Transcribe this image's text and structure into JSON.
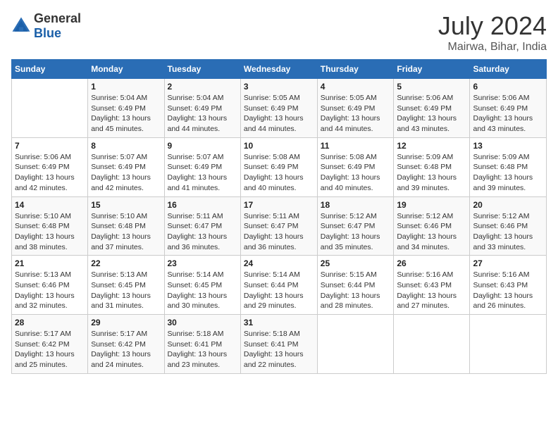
{
  "logo": {
    "general": "General",
    "blue": "Blue"
  },
  "title": "July 2024",
  "subtitle": "Mairwa, Bihar, India",
  "header_days": [
    "Sunday",
    "Monday",
    "Tuesday",
    "Wednesday",
    "Thursday",
    "Friday",
    "Saturday"
  ],
  "weeks": [
    [
      {
        "day": "",
        "info": ""
      },
      {
        "day": "1",
        "info": "Sunrise: 5:04 AM\nSunset: 6:49 PM\nDaylight: 13 hours\nand 45 minutes."
      },
      {
        "day": "2",
        "info": "Sunrise: 5:04 AM\nSunset: 6:49 PM\nDaylight: 13 hours\nand 44 minutes."
      },
      {
        "day": "3",
        "info": "Sunrise: 5:05 AM\nSunset: 6:49 PM\nDaylight: 13 hours\nand 44 minutes."
      },
      {
        "day": "4",
        "info": "Sunrise: 5:05 AM\nSunset: 6:49 PM\nDaylight: 13 hours\nand 44 minutes."
      },
      {
        "day": "5",
        "info": "Sunrise: 5:06 AM\nSunset: 6:49 PM\nDaylight: 13 hours\nand 43 minutes."
      },
      {
        "day": "6",
        "info": "Sunrise: 5:06 AM\nSunset: 6:49 PM\nDaylight: 13 hours\nand 43 minutes."
      }
    ],
    [
      {
        "day": "7",
        "info": "Sunrise: 5:06 AM\nSunset: 6:49 PM\nDaylight: 13 hours\nand 42 minutes."
      },
      {
        "day": "8",
        "info": "Sunrise: 5:07 AM\nSunset: 6:49 PM\nDaylight: 13 hours\nand 42 minutes."
      },
      {
        "day": "9",
        "info": "Sunrise: 5:07 AM\nSunset: 6:49 PM\nDaylight: 13 hours\nand 41 minutes."
      },
      {
        "day": "10",
        "info": "Sunrise: 5:08 AM\nSunset: 6:49 PM\nDaylight: 13 hours\nand 40 minutes."
      },
      {
        "day": "11",
        "info": "Sunrise: 5:08 AM\nSunset: 6:49 PM\nDaylight: 13 hours\nand 40 minutes."
      },
      {
        "day": "12",
        "info": "Sunrise: 5:09 AM\nSunset: 6:48 PM\nDaylight: 13 hours\nand 39 minutes."
      },
      {
        "day": "13",
        "info": "Sunrise: 5:09 AM\nSunset: 6:48 PM\nDaylight: 13 hours\nand 39 minutes."
      }
    ],
    [
      {
        "day": "14",
        "info": "Sunrise: 5:10 AM\nSunset: 6:48 PM\nDaylight: 13 hours\nand 38 minutes."
      },
      {
        "day": "15",
        "info": "Sunrise: 5:10 AM\nSunset: 6:48 PM\nDaylight: 13 hours\nand 37 minutes."
      },
      {
        "day": "16",
        "info": "Sunrise: 5:11 AM\nSunset: 6:47 PM\nDaylight: 13 hours\nand 36 minutes."
      },
      {
        "day": "17",
        "info": "Sunrise: 5:11 AM\nSunset: 6:47 PM\nDaylight: 13 hours\nand 36 minutes."
      },
      {
        "day": "18",
        "info": "Sunrise: 5:12 AM\nSunset: 6:47 PM\nDaylight: 13 hours\nand 35 minutes."
      },
      {
        "day": "19",
        "info": "Sunrise: 5:12 AM\nSunset: 6:46 PM\nDaylight: 13 hours\nand 34 minutes."
      },
      {
        "day": "20",
        "info": "Sunrise: 5:12 AM\nSunset: 6:46 PM\nDaylight: 13 hours\nand 33 minutes."
      }
    ],
    [
      {
        "day": "21",
        "info": "Sunrise: 5:13 AM\nSunset: 6:46 PM\nDaylight: 13 hours\nand 32 minutes."
      },
      {
        "day": "22",
        "info": "Sunrise: 5:13 AM\nSunset: 6:45 PM\nDaylight: 13 hours\nand 31 minutes."
      },
      {
        "day": "23",
        "info": "Sunrise: 5:14 AM\nSunset: 6:45 PM\nDaylight: 13 hours\nand 30 minutes."
      },
      {
        "day": "24",
        "info": "Sunrise: 5:14 AM\nSunset: 6:44 PM\nDaylight: 13 hours\nand 29 minutes."
      },
      {
        "day": "25",
        "info": "Sunrise: 5:15 AM\nSunset: 6:44 PM\nDaylight: 13 hours\nand 28 minutes."
      },
      {
        "day": "26",
        "info": "Sunrise: 5:16 AM\nSunset: 6:43 PM\nDaylight: 13 hours\nand 27 minutes."
      },
      {
        "day": "27",
        "info": "Sunrise: 5:16 AM\nSunset: 6:43 PM\nDaylight: 13 hours\nand 26 minutes."
      }
    ],
    [
      {
        "day": "28",
        "info": "Sunrise: 5:17 AM\nSunset: 6:42 PM\nDaylight: 13 hours\nand 25 minutes."
      },
      {
        "day": "29",
        "info": "Sunrise: 5:17 AM\nSunset: 6:42 PM\nDaylight: 13 hours\nand 24 minutes."
      },
      {
        "day": "30",
        "info": "Sunrise: 5:18 AM\nSunset: 6:41 PM\nDaylight: 13 hours\nand 23 minutes."
      },
      {
        "day": "31",
        "info": "Sunrise: 5:18 AM\nSunset: 6:41 PM\nDaylight: 13 hours\nand 22 minutes."
      },
      {
        "day": "",
        "info": ""
      },
      {
        "day": "",
        "info": ""
      },
      {
        "day": "",
        "info": ""
      }
    ]
  ]
}
